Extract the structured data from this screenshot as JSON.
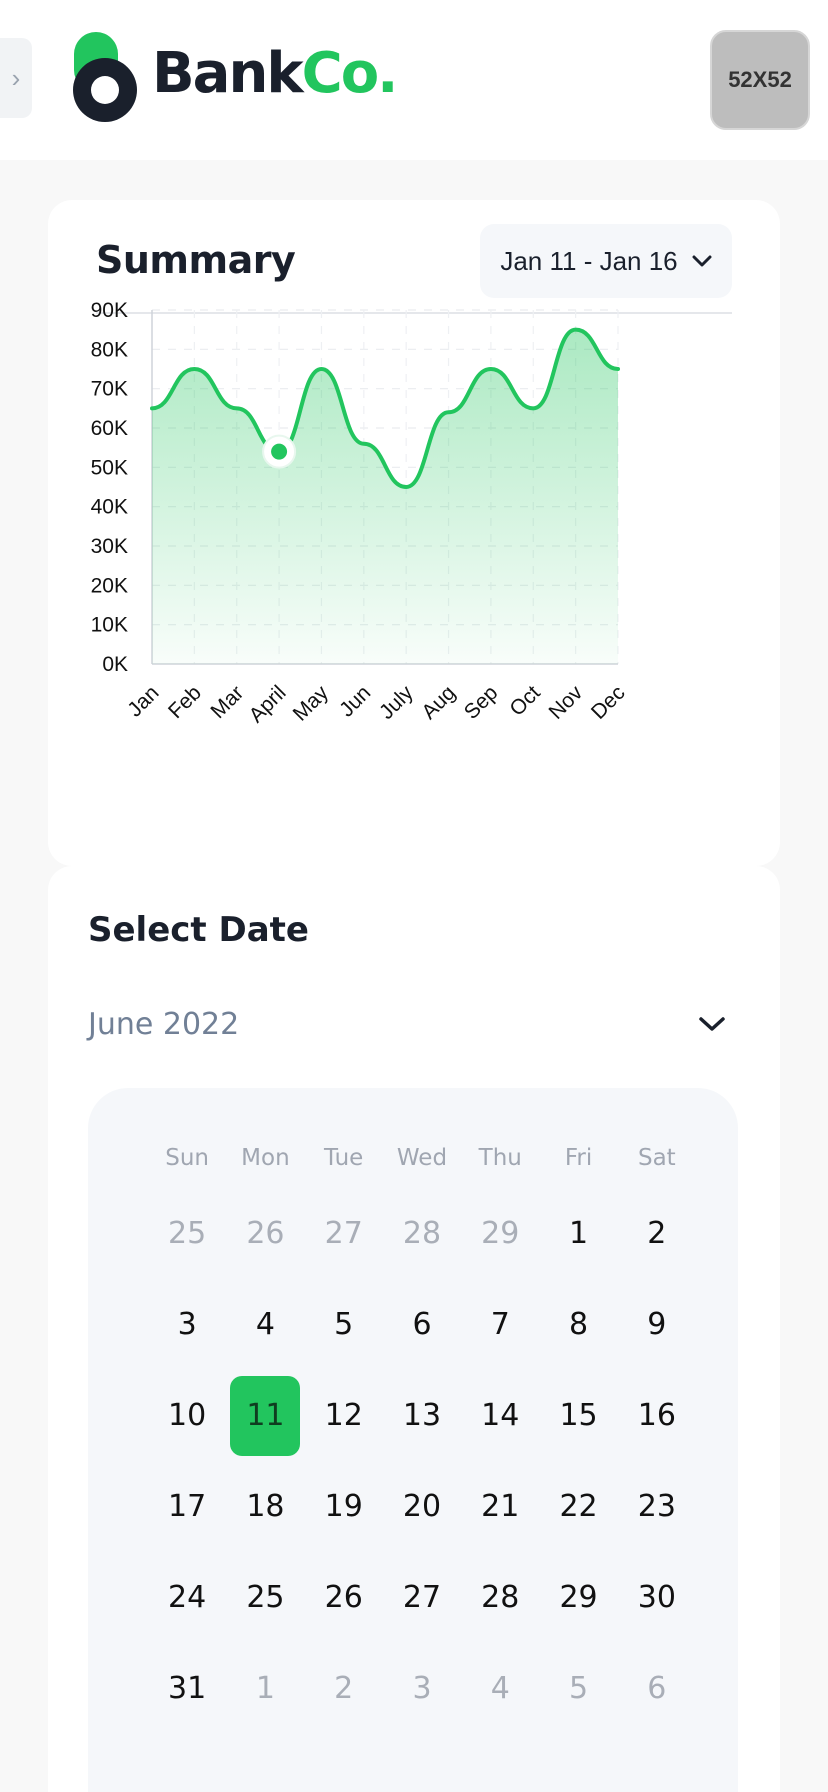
{
  "header": {
    "brand_part1": "Bank",
    "brand_part2": "Co.",
    "avatar_text": "52X52",
    "side_toggle_icon": "chevron-right-icon"
  },
  "summary": {
    "title": "Summary",
    "range_label": "Jan 11 - Jan 16"
  },
  "chart_data": {
    "type": "area",
    "categories": [
      "Jan",
      "Feb",
      "Mar",
      "April",
      "May",
      "Jun",
      "July",
      "Aug",
      "Sep",
      "Oct",
      "Nov",
      "Dec"
    ],
    "series": [
      {
        "values": [
          65000,
          75000,
          65000,
          54000,
          75000,
          56000,
          45000,
          64000,
          75000,
          65000,
          85000,
          75000
        ]
      }
    ],
    "y_ticks": [
      "0K",
      "10K",
      "20K",
      "30K",
      "40K",
      "50K",
      "60K",
      "70K",
      "80K",
      "90K"
    ],
    "ylim": [
      0,
      90000
    ],
    "highlighted_point": {
      "category": "April",
      "value": 54000
    },
    "grid": true,
    "color": "#22c55e"
  },
  "select_date": {
    "title": "Select Date",
    "month_label": "June 2022",
    "weekdays": [
      "Sun",
      "Mon",
      "Tue",
      "Wed",
      "Thu",
      "Fri",
      "Sat"
    ],
    "weeks": [
      [
        {
          "d": "25",
          "m": true
        },
        {
          "d": "26",
          "m": true
        },
        {
          "d": "27",
          "m": true
        },
        {
          "d": "28",
          "m": true
        },
        {
          "d": "29",
          "m": true
        },
        {
          "d": "1"
        },
        {
          "d": "2"
        }
      ],
      [
        {
          "d": "3"
        },
        {
          "d": "4"
        },
        {
          "d": "5"
        },
        {
          "d": "6"
        },
        {
          "d": "7"
        },
        {
          "d": "8"
        },
        {
          "d": "9"
        }
      ],
      [
        {
          "d": "10"
        },
        {
          "d": "11",
          "s": true
        },
        {
          "d": "12"
        },
        {
          "d": "13"
        },
        {
          "d": "14"
        },
        {
          "d": "15"
        },
        {
          "d": "16"
        }
      ],
      [
        {
          "d": "17"
        },
        {
          "d": "18"
        },
        {
          "d": "19"
        },
        {
          "d": "20"
        },
        {
          "d": "21"
        },
        {
          "d": "22"
        },
        {
          "d": "23"
        }
      ],
      [
        {
          "d": "24"
        },
        {
          "d": "25"
        },
        {
          "d": "26"
        },
        {
          "d": "27"
        },
        {
          "d": "28"
        },
        {
          "d": "29"
        },
        {
          "d": "30"
        }
      ],
      [
        {
          "d": "31"
        },
        {
          "d": "1",
          "m": true
        },
        {
          "d": "2",
          "m": true
        },
        {
          "d": "3",
          "m": true
        },
        {
          "d": "4",
          "m": true
        },
        {
          "d": "5",
          "m": true
        },
        {
          "d": "6",
          "m": true
        }
      ]
    ],
    "accent_color": "#22c55e"
  }
}
